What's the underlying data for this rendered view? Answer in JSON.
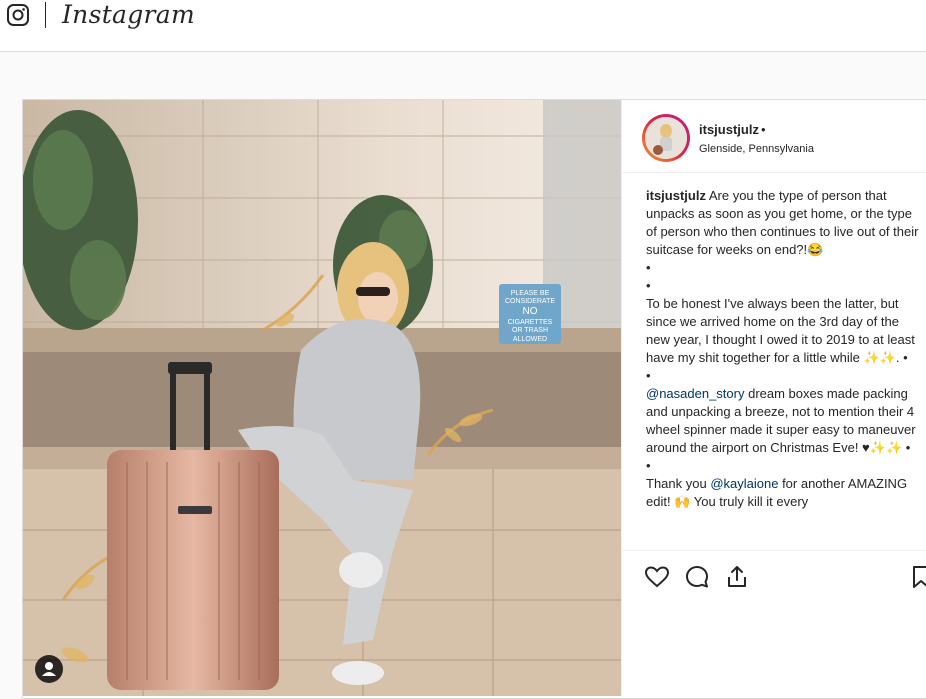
{
  "brand": {
    "name": "Instagram"
  },
  "post": {
    "username": "itsjustjulz",
    "follow_dot": "•",
    "location": "Glenside, Pennsylvania",
    "caption": {
      "username": "itsjustjulz",
      "lines": [
        " Are you the type of person that unpacks as soon as you get home, or the type of person who then continues to live out of their suitcase for weeks on end?!😂",
        "•",
        "•",
        "To be honest I've always been the latter, but since we arrived home on the 3rd day of the new year, I thought I owed it to 2019 to at least have my shit together for a little while ✨✨. •",
        "•"
      ],
      "mention_line": {
        "mention": "@nasaden_story",
        "text": " dream boxes made packing and unpacking a breeze, not to mention their 4 wheel spinner made it super easy to maneuver around the airport on Christmas Eve! ♥✨✨ •"
      },
      "dot_line": "•",
      "thanks_line": {
        "before": "Thank you ",
        "mention": "@kaylaione",
        "after": " for another AMAZING edit! 🙌 You truly kill it every"
      }
    },
    "photo": {
      "sign_text": [
        "PLEASE BE",
        "CONSIDERATE",
        "NO",
        "CIGARETTES",
        "OR TRASH",
        "ALLOWED"
      ]
    }
  },
  "icons": {
    "logo": "instagram-glyph-icon",
    "like": "heart-icon",
    "comment": "comment-bubble-icon",
    "share": "share-icon",
    "save": "bookmark-icon",
    "tag": "user-tag-icon"
  },
  "colors": {
    "link": "#003569",
    "border": "#dbdbdb",
    "text": "#262626"
  }
}
